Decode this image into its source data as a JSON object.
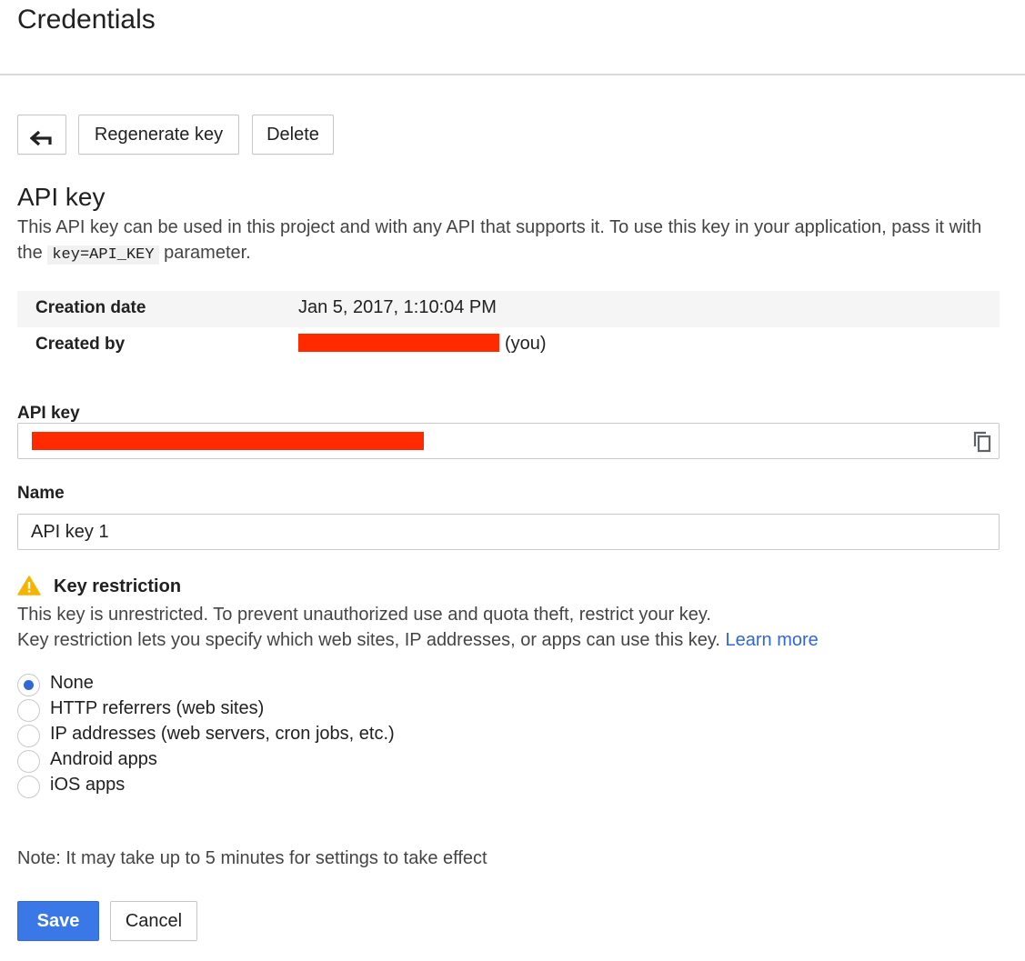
{
  "header": {
    "title": "Credentials"
  },
  "toolbar": {
    "back_icon": "back-arrow-icon",
    "regenerate_label": "Regenerate key",
    "delete_label": "Delete"
  },
  "api_key_section": {
    "title": "API key",
    "description_part1": "This API key can be used in this project and with any API that supports it. To use this key in your application, pass it with the ",
    "code": "key=API_KEY",
    "description_part2": " parameter."
  },
  "info": {
    "creation_date_label": "Creation date",
    "creation_date_value": "Jan 5, 2017, 1:10:04 PM",
    "created_by_label": "Created by",
    "created_by_suffix": "(you)"
  },
  "api_key_field": {
    "label": "API key",
    "copy_icon": "copy-icon",
    "redaction_color": "#ff2a00"
  },
  "name_field": {
    "label": "Name",
    "value": "API key 1"
  },
  "restriction": {
    "icon": "warning-icon",
    "title": "Key restriction",
    "line1": "This key is unrestricted. To prevent unauthorized use and quota theft, restrict your key.",
    "line2": "Key restriction lets you specify which web sites, IP addresses, or apps can use this key. ",
    "learn_more": "Learn more",
    "options": [
      {
        "label": "None",
        "checked": true
      },
      {
        "label": "HTTP referrers (web sites)",
        "checked": false
      },
      {
        "label": "IP addresses (web servers, cron jobs, etc.)",
        "checked": false
      },
      {
        "label": "Android apps",
        "checked": false
      },
      {
        "label": "iOS apps",
        "checked": false
      }
    ]
  },
  "footer": {
    "note": "Note: It may take up to 5 minutes for settings to take effect",
    "save_label": "Save",
    "cancel_label": "Cancel"
  },
  "colors": {
    "accent": "#3367d6",
    "warning": "#f4b400"
  }
}
